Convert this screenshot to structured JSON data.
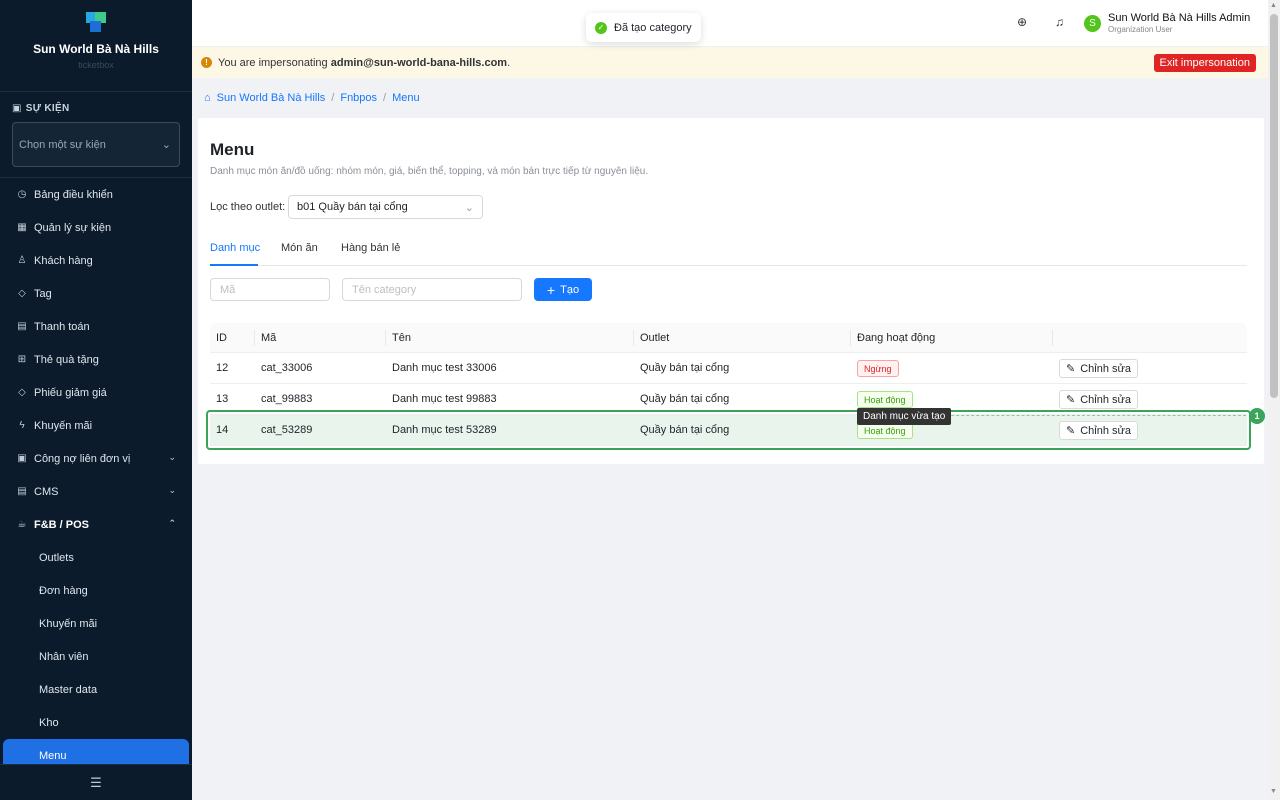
{
  "sidebar": {
    "brand_name": "Sun World Bà Nà Hills",
    "brand_sub": "ticketbox",
    "section_title": "SỰ KIỆN",
    "event_placeholder": "Chọn một sự kiện",
    "items": [
      {
        "label": "Bảng điều khiển",
        "icon": "dashboard-icon"
      },
      {
        "label": "Quản lý sự kiện",
        "icon": "calendar-icon"
      },
      {
        "label": "Khách hàng",
        "icon": "user-icon"
      },
      {
        "label": "Tag",
        "icon": "tag-icon"
      },
      {
        "label": "Thanh toán",
        "icon": "payment-icon"
      },
      {
        "label": "Thẻ quà tặng",
        "icon": "gift-icon"
      },
      {
        "label": "Phiếu giảm giá",
        "icon": "coupon-icon"
      },
      {
        "label": "Khuyến mãi",
        "icon": "bolt-icon"
      },
      {
        "label": "Công nợ liên đơn vị",
        "icon": "debt-icon"
      },
      {
        "label": "CMS",
        "icon": "cms-icon"
      },
      {
        "label": "F&B / POS",
        "icon": "cup-icon"
      }
    ],
    "subitems": [
      "Outlets",
      "Đơn hàng",
      "Khuyến mãi",
      "Nhân viên",
      "Master data",
      "Kho",
      "Menu"
    ]
  },
  "toast": {
    "text": "Đã tạo category"
  },
  "user": {
    "name": "Sun World Bà Nà Hills Admin",
    "role": "Organization User",
    "initial": "S"
  },
  "impersonation": {
    "prefix": "You are impersonating ",
    "email": "admin@sun-world-bana-hills.com",
    "suffix": ".",
    "exit_label": "Exit impersonation"
  },
  "breadcrumb": [
    "Sun World Bà Nà Hills",
    "Fnbpos",
    "Menu"
  ],
  "page": {
    "title": "Menu",
    "description": "Danh mục món ăn/đồ uống: nhóm món, giá, biến thể, topping, và món bán trực tiếp từ nguyên liệu.",
    "filter_label": "Lọc theo outlet:",
    "filter_value": "b01 Quầy bán tại cổng"
  },
  "tabs": [
    "Danh mục",
    "Món ăn",
    "Hàng bán lẻ"
  ],
  "form": {
    "code_placeholder": "Mã",
    "name_placeholder": "Tên category",
    "create_label": "Tạo"
  },
  "table": {
    "headers": [
      "ID",
      "Mã",
      "Tên",
      "Outlet",
      "Đang hoạt động"
    ],
    "edit_label": "Chỉnh sửa",
    "rows": [
      {
        "id": "12",
        "code": "cat_33006",
        "name": "Danh mục test 33006",
        "outlet": "Quầy bán tại cổng",
        "status": "Ngừng"
      },
      {
        "id": "13",
        "code": "cat_99883",
        "name": "Danh mục test 99883",
        "outlet": "Quầy bán tại cổng",
        "status": "Hoạt động"
      },
      {
        "id": "14",
        "code": "cat_53289",
        "name": "Danh mục test 53289",
        "outlet": "Quầy bán tại cổng",
        "status": "Hoạt động"
      }
    ]
  },
  "annotation": {
    "tooltip": "Danh mục vừa tạo",
    "number": "1"
  },
  "colors": {
    "primary": "#1677ff",
    "sidebar": "#0b1b2b",
    "danger": "#e02424",
    "success": "#52c41a"
  }
}
